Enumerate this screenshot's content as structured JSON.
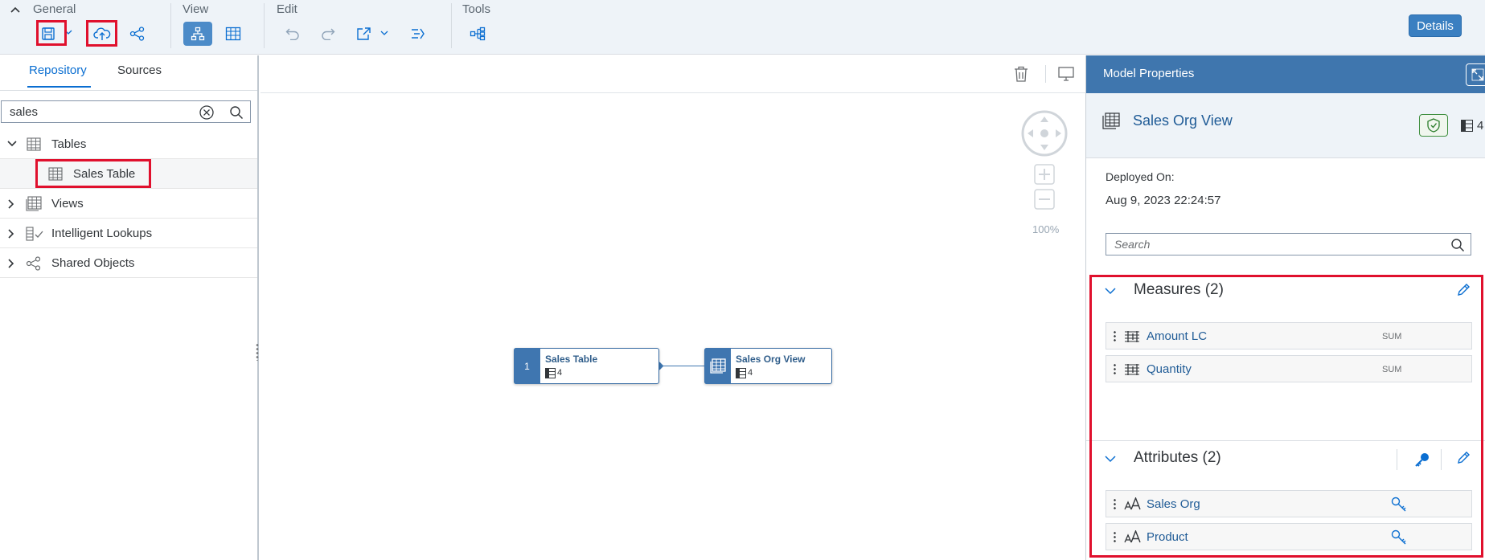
{
  "toolbar": {
    "groups": {
      "general": "General",
      "view": "View",
      "edit": "Edit",
      "tools": "Tools"
    },
    "details_label": "Details",
    "icons": [
      "collapse-icon",
      "save-icon",
      "deploy-icon",
      "share-icon",
      "diagram-view-icon",
      "table-view-icon",
      "undo-icon",
      "redo-icon",
      "export-icon",
      "impact-lineage-icon",
      "tools-icon"
    ]
  },
  "left_panel": {
    "tabs": [
      "Repository",
      "Sources"
    ],
    "search_value": "sales",
    "tree": [
      {
        "label": "Tables",
        "expanded": true
      },
      {
        "label": "Sales Table",
        "child": true
      },
      {
        "label": "Views"
      },
      {
        "label": "Intelligent Lookups"
      },
      {
        "label": "Shared Objects"
      }
    ]
  },
  "canvas": {
    "zoom": "100%",
    "nodes": [
      {
        "index": "1",
        "title": "Sales Table",
        "count": "4"
      },
      {
        "title": "Sales Org View",
        "count": "4"
      }
    ]
  },
  "right_panel": {
    "title": "Model Properties",
    "view_name": "Sales Org View",
    "header_count": "4",
    "deployed_label": "Deployed On:",
    "deployed_value": "Aug 9, 2023 22:24:57",
    "search_placeholder": "Search",
    "measures": {
      "title": "Measures (2)",
      "items": [
        {
          "label": "Amount LC",
          "agg": "SUM"
        },
        {
          "label": "Quantity",
          "agg": "SUM"
        }
      ]
    },
    "attributes": {
      "title": "Attributes (2)",
      "items": [
        {
          "label": "Sales Org"
        },
        {
          "label": "Product"
        }
      ]
    }
  },
  "colors": {
    "accent": "#0a6ed1",
    "header_blue": "#3f76ae",
    "highlight_red": "#e0102d"
  }
}
